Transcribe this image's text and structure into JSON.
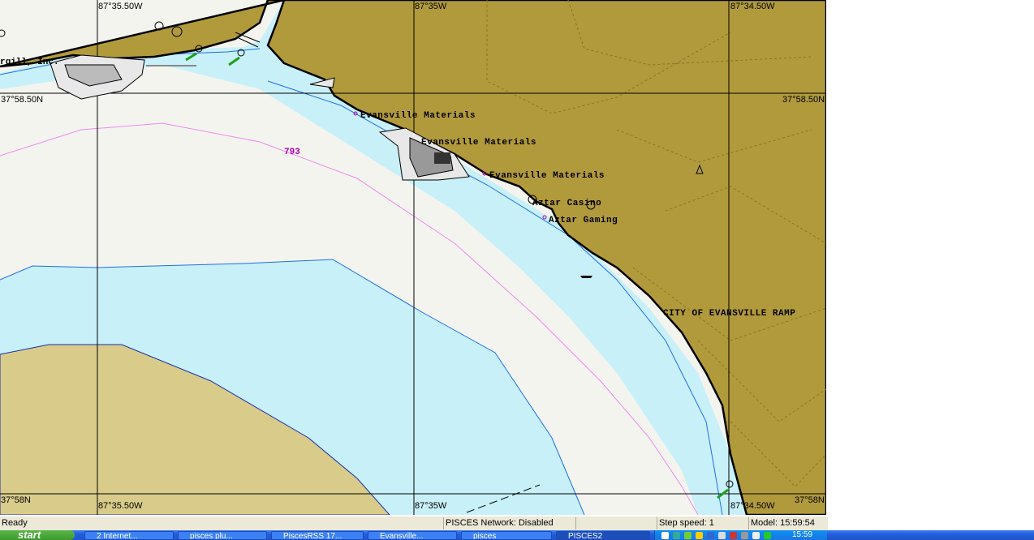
{
  "map": {
    "longitude_labels": {
      "top_left": "87°35.50W",
      "top_mid": "87°35W",
      "top_right": "87°34.50W",
      "bottom_left": "87°35.50W",
      "bottom_mid": "87°35W",
      "bottom_right": "87°34.50W"
    },
    "latitude_labels": {
      "upper_left": "37°58.50N",
      "upper_right": "37°58.50N",
      "lower_left": "37°58N",
      "lower_right": "37°58N"
    },
    "place_labels": {
      "evansville_materials_1": "Evansville Materials",
      "evansville_materials_2": "Evansville Materials",
      "evansville_materials_3": "Evansville Materials",
      "aztar_casino": "Aztar Casino",
      "aztar_gaming": "Aztar Gaming",
      "city_ramp": "CITY OF EVANSVILLE RAMP",
      "cargill_partial": "rgill, Inc."
    },
    "depth_label": "793",
    "colors": {
      "land": "#b19a3c",
      "land_far": "#d9cc8a",
      "shallow_water": "#c8f0f8",
      "deep_water": "#f4f4ef",
      "depth_contour": "#ee88ee",
      "shoreline": "#000000",
      "buoy": "#1aa01a"
    }
  },
  "status": {
    "ready": "Ready",
    "network": "PISCES Network: Disabled",
    "step_speed": "Step speed: 1",
    "model_time": "Model: 15:59:54"
  },
  "taskbar": {
    "start": "start",
    "tasks": [
      "2 Internet...",
      "pisces plu...",
      "PiscesRSS 17...",
      "Evansville...",
      "pisces",
      "PISCES2"
    ],
    "clock": "15:59"
  }
}
